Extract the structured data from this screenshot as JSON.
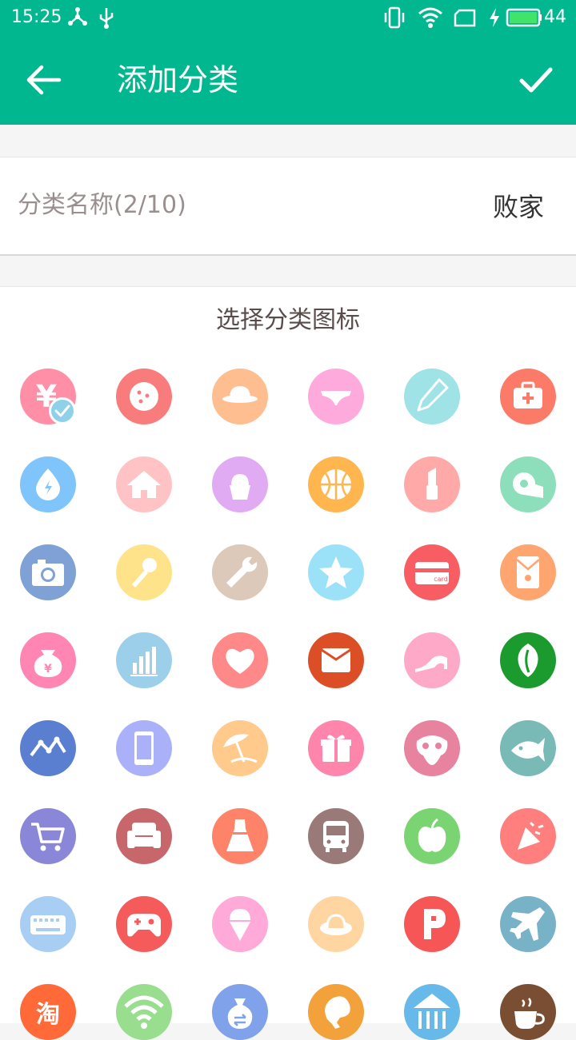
{
  "status_bar": {
    "time": "15:25",
    "battery": "44"
  },
  "header": {
    "title": "添加分类"
  },
  "form": {
    "name_label": "分类名称(2/10)",
    "name_value": "败家"
  },
  "icons_section": {
    "title": "选择分类图标",
    "selected_index": 0,
    "icons": [
      {
        "name": "money-yuan-icon",
        "color": "#ff8fa6"
      },
      {
        "name": "cookie-icon",
        "color": "#f87c7c"
      },
      {
        "name": "hat-icon",
        "color": "#ffbe8f"
      },
      {
        "name": "underwear-icon",
        "color": "#ffaadc"
      },
      {
        "name": "pencil-icon",
        "color": "#9fe3e6"
      },
      {
        "name": "first-aid-icon",
        "color": "#fb7a68"
      },
      {
        "name": "water-drop-icon",
        "color": "#7fc4fb"
      },
      {
        "name": "house-icon",
        "color": "#ffc3c5"
      },
      {
        "name": "ice-cream-cup-icon",
        "color": "#e0abf3"
      },
      {
        "name": "basketball-icon",
        "color": "#ffb64f"
      },
      {
        "name": "lipstick-icon",
        "color": "#ffaaa9"
      },
      {
        "name": "toilet-paper-icon",
        "color": "#8ddfbb"
      },
      {
        "name": "camera-icon",
        "color": "#7fa1d6"
      },
      {
        "name": "microphone-icon",
        "color": "#ffe38a"
      },
      {
        "name": "wrench-icon",
        "color": "#dcc9b9"
      },
      {
        "name": "star-icon",
        "color": "#9be1f8"
      },
      {
        "name": "card-icon",
        "color": "#f75d63"
      },
      {
        "name": "red-envelope-icon",
        "color": "#ffa56f"
      },
      {
        "name": "money-bag-icon",
        "color": "#ff85b3"
      },
      {
        "name": "bar-chart-icon",
        "color": "#9ccfea"
      },
      {
        "name": "heart-icon",
        "color": "#ff8888"
      },
      {
        "name": "envelope-icon",
        "color": "#dc4e26"
      },
      {
        "name": "high-heel-icon",
        "color": "#ffa9c9"
      },
      {
        "name": "leaf-icon",
        "color": "#1b9a2e"
      },
      {
        "name": "line-chart-icon",
        "color": "#5a7fd0"
      },
      {
        "name": "phone-icon",
        "color": "#aab1f9"
      },
      {
        "name": "beach-umbrella-icon",
        "color": "#ffca8b"
      },
      {
        "name": "gift-icon",
        "color": "#ff85ad"
      },
      {
        "name": "mask-icon",
        "color": "#e7839f"
      },
      {
        "name": "fish-icon",
        "color": "#79bab6"
      },
      {
        "name": "cart-icon",
        "color": "#8a87d8"
      },
      {
        "name": "sofa-icon",
        "color": "#c8676b"
      },
      {
        "name": "dress-icon",
        "color": "#ff8368"
      },
      {
        "name": "bus-icon",
        "color": "#9a7a78"
      },
      {
        "name": "apple-icon",
        "color": "#7ad471"
      },
      {
        "name": "party-popper-icon",
        "color": "#ff7e7e"
      },
      {
        "name": "keyboard-icon",
        "color": "#a8cff3"
      },
      {
        "name": "gamepad-icon",
        "color": "#f65b5c"
      },
      {
        "name": "ice-cream-cone-icon",
        "color": "#ffaad9"
      },
      {
        "name": "sun-hat-icon",
        "color": "#ffd6a1"
      },
      {
        "name": "parking-icon",
        "color": "#f65656"
      },
      {
        "name": "airplane-icon",
        "color": "#77b2c7"
      },
      {
        "name": "taobao-icon",
        "color": "#ff6a38"
      },
      {
        "name": "wifi-icon",
        "color": "#99dd8f"
      },
      {
        "name": "money-exchange-icon",
        "color": "#7fa2ea"
      },
      {
        "name": "chicken-leg-icon",
        "color": "#f2a13b"
      },
      {
        "name": "bank-icon",
        "color": "#66b9e8"
      },
      {
        "name": "coffee-icon",
        "color": "#7a4e33"
      }
    ]
  }
}
